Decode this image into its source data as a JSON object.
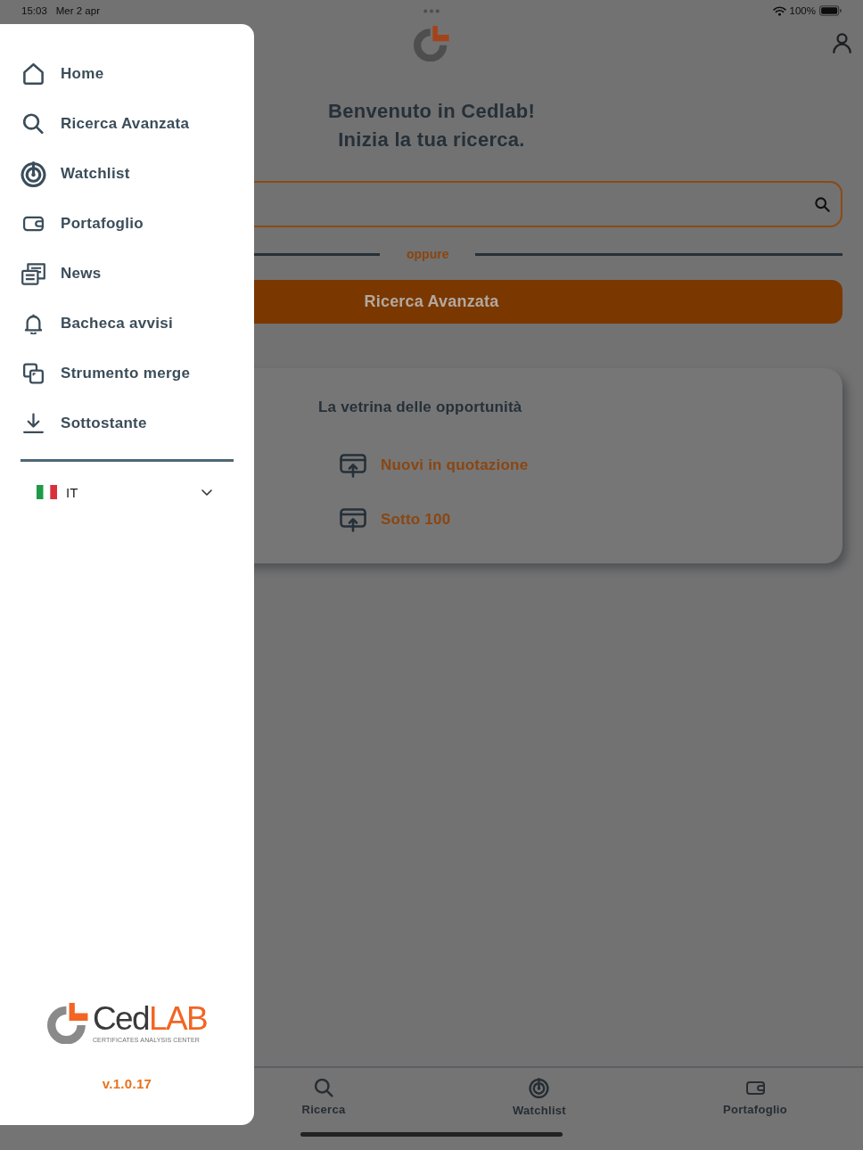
{
  "status_bar": {
    "time": "15:03",
    "date": "Mer 2 apr",
    "battery": "100%"
  },
  "drawer": {
    "items": [
      {
        "label": "Home"
      },
      {
        "label": "Ricerca Avanzata"
      },
      {
        "label": "Watchlist"
      },
      {
        "label": "Portafoglio"
      },
      {
        "label": "News"
      },
      {
        "label": "Bacheca avvisi"
      },
      {
        "label": "Strumento merge"
      },
      {
        "label": "Sottostante"
      }
    ],
    "language": {
      "label": "IT"
    },
    "logo": {
      "wordmark": "Ced",
      "wordmark_accent": "LAB",
      "tagline": "CERTIFICATES ANALYSIS CENTER"
    },
    "version": "v.1.0.17"
  },
  "main": {
    "title": "Benvenuto in Cedlab!",
    "subtitle": "Inizia la tua ricerca.",
    "divider_text": "oppure",
    "advanced_search_button": "Ricerca Avanzata",
    "showcase": {
      "title": "La vetrina delle opportunità",
      "links": [
        {
          "label": "Nuovi in quotazione"
        },
        {
          "label": "Sotto 100"
        }
      ]
    }
  },
  "tab_bar": {
    "tabs": [
      {
        "label": "Ricerca"
      },
      {
        "label": "Watchlist"
      },
      {
        "label": "Portafoglio"
      }
    ]
  }
}
